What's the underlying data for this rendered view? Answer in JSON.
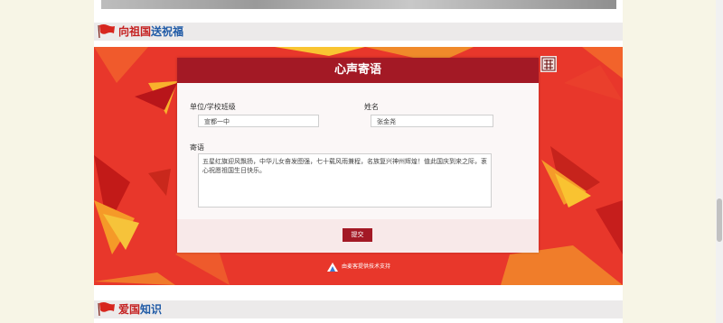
{
  "sections": {
    "greeting": {
      "title_part1": "向祖国",
      "title_part2": "送祝福"
    },
    "knowledge": {
      "title_part1": "爱国",
      "title_part2": "知识"
    }
  },
  "form": {
    "header": "心声寄语",
    "unit_label": "单位/学校班级",
    "unit_value": "宣都一中",
    "name_label": "姓名",
    "name_value": "张金尧",
    "message_label": "寄语",
    "message_value": "五星红旗迎风飘扬，中华儿女奋发图强，七十载风雨兼程，名族复兴神州辉煌！值此国庆到来之际，衷心祝愿祖国生日快乐。",
    "submit_label": "提交"
  },
  "credit": {
    "text": "由麦客提供技术支持"
  },
  "icons": {
    "flag": "flag-icon",
    "stamp": "stamp-icon",
    "credit_logo": "maike-logo-icon"
  },
  "colors": {
    "accent_red": "#a31925",
    "banner_red": "#e8372b",
    "title_red": "#c41f1f",
    "title_blue": "#1f5aa6"
  }
}
